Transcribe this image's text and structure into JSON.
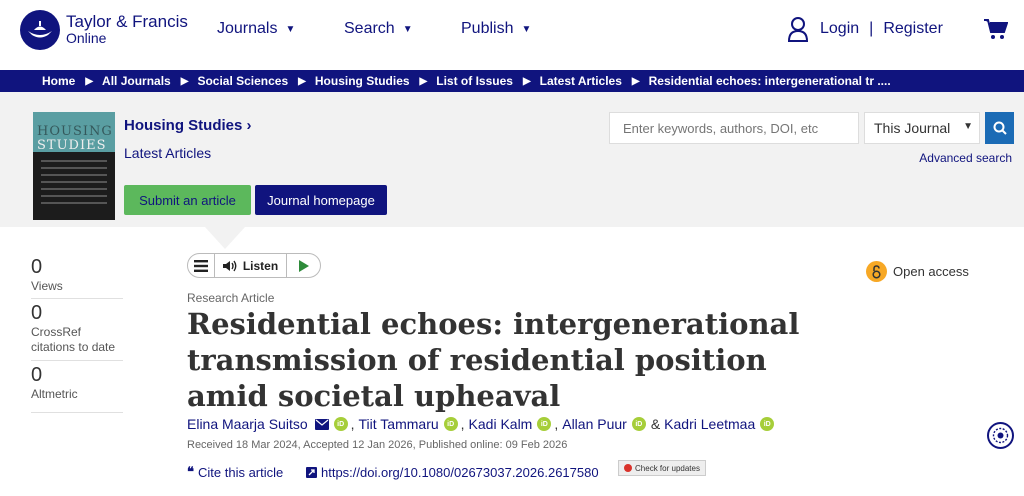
{
  "header": {
    "logo_line1": "Taylor & Francis",
    "logo_line2": "Online",
    "nav": [
      {
        "label": "Journals"
      },
      {
        "label": "Search"
      },
      {
        "label": "Publish"
      }
    ],
    "login": "Login",
    "separator": "|",
    "register": "Register"
  },
  "breadcrumb": [
    "Home",
    "All Journals",
    "Social Sciences",
    "Housing Studies",
    "List of Issues",
    "Latest Articles",
    "Residential echoes: intergenerational tr ...."
  ],
  "journal": {
    "cover_title": "HOUSING STUDIES",
    "title": "Housing Studies",
    "title_chevron": "›",
    "subtitle": "Latest Articles",
    "submit_label": "Submit an article",
    "homepage_label": "Journal homepage"
  },
  "search": {
    "placeholder": "Enter keywords, authors, DOI, etc",
    "scope": "This Journal",
    "advanced": "Advanced search"
  },
  "metrics": [
    {
      "value": "0",
      "label": "Views"
    },
    {
      "value": "0",
      "label": "CrossRef citations to date"
    },
    {
      "value": "0",
      "label": "Altmetric"
    }
  ],
  "listen": {
    "label": "Listen"
  },
  "open_access": "Open access",
  "article": {
    "type": "Research Article",
    "title": "Residential echoes: intergenerational transmission of residential position amid societal upheaval",
    "authors": [
      "Elina Maarja Suitso",
      "Tiit Tammaru",
      "Kadi Kalm",
      "Allan Puur",
      "Kadri Leetmaa"
    ],
    "author_separators": [
      ",",
      ",",
      ",",
      "&"
    ],
    "dates": "Received 18 Mar 2024, Accepted 12 Jan 2026, Published online: 09 Feb 2026",
    "cite_label": "Cite this article",
    "doi": "https://doi.org/10.1080/02673037.2026.2617580",
    "check_updates": "Check for updates"
  },
  "colors": {
    "brand": "#10147e",
    "submit": "#5cb85c",
    "search_button": "#1b6bb5",
    "orcid": "#a6ce39",
    "open_access": "#f7a825"
  }
}
